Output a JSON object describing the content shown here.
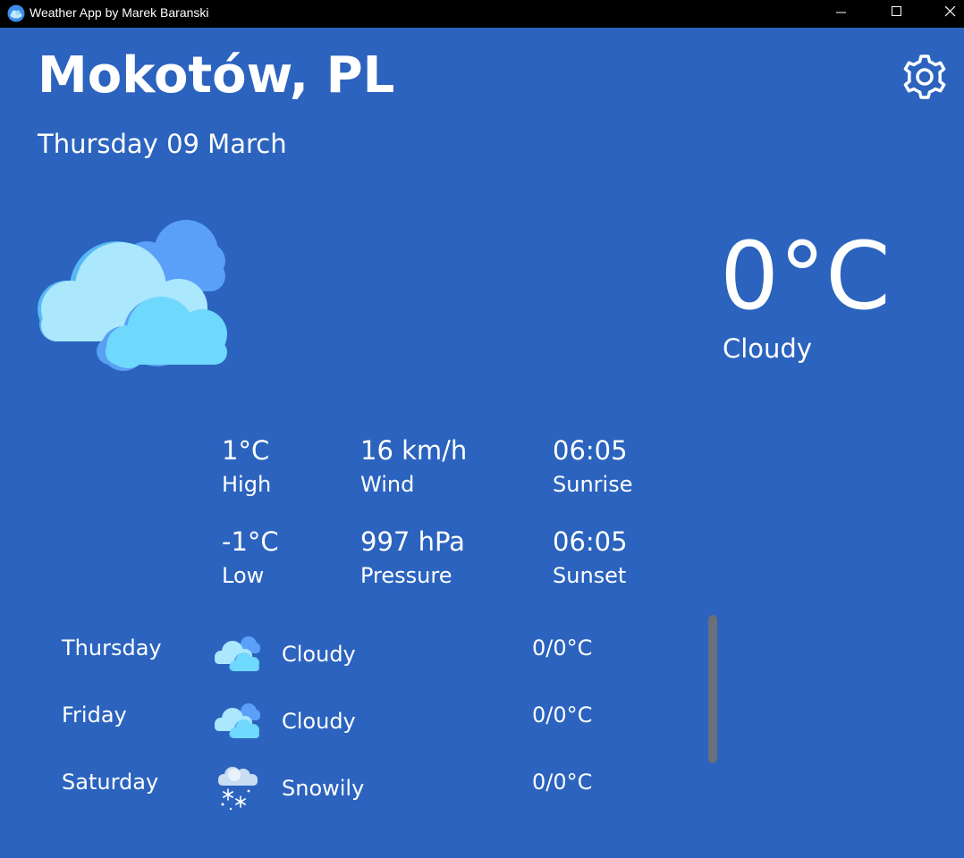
{
  "window": {
    "title": "Weather App by Marek Baranski",
    "app_icon": "weather-app-icon"
  },
  "header": {
    "city": "Mokotów, PL",
    "date": "Thursday 09 March",
    "settings_icon": "gear-icon"
  },
  "current": {
    "icon": "cloudy-icon",
    "temperature": "0°C",
    "condition": "Cloudy"
  },
  "stats": {
    "high_value": "1°C",
    "high_label": "High",
    "low_value": "-1°C",
    "low_label": "Low",
    "wind_value": "16 km/h",
    "wind_label": "Wind",
    "pressure_value": "997 hPa",
    "pressure_label": "Pressure",
    "sunrise_value": "06:05",
    "sunrise_label": "Sunrise",
    "sunset_value": "06:05",
    "sunset_label": "Sunset"
  },
  "forecast": [
    {
      "day": "Thursday",
      "icon": "cloudy-icon",
      "condition": "Cloudy",
      "temp": "0/0°C"
    },
    {
      "day": "Friday",
      "icon": "cloudy-icon",
      "condition": "Cloudy",
      "temp": "0/0°C"
    },
    {
      "day": "Saturday",
      "icon": "snow-icon",
      "condition": "Snowily",
      "temp": "0/0°C"
    }
  ],
  "colors": {
    "background": "#2b63be",
    "titlebar": "#000000",
    "text": "#ffffff",
    "scrollbar": "#6a6f78"
  }
}
